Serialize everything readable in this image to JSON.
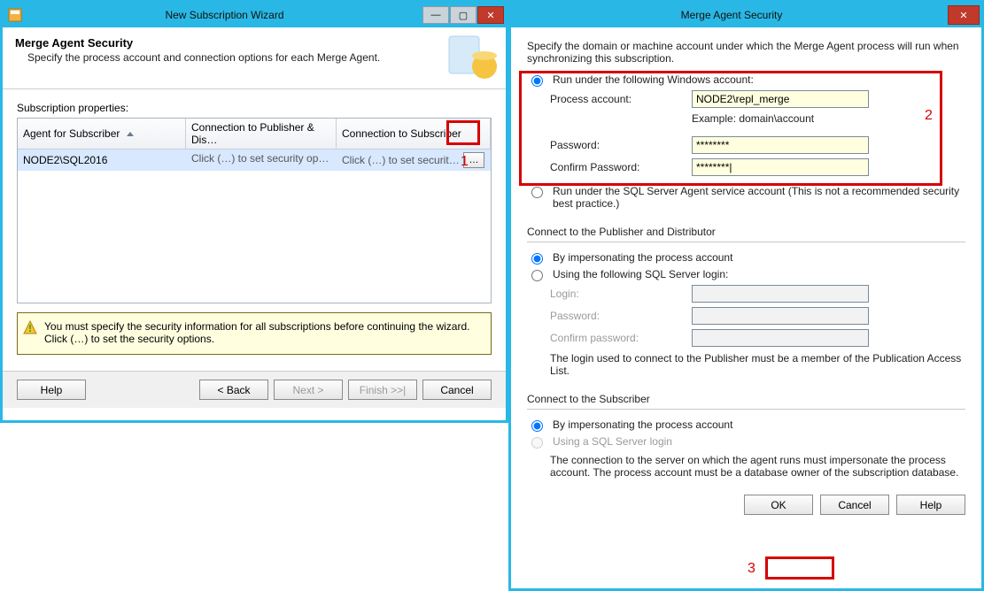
{
  "wizard": {
    "title": "New Subscription Wizard",
    "page_heading": "Merge Agent Security",
    "page_sub": "Specify the process account and connection options for each Merge Agent.",
    "grid_label": "Subscription properties:",
    "columns": {
      "agent": "Agent for Subscriber",
      "conn_pub": "Connection to Publisher & Dis…",
      "conn_sub": "Connection to Subscriber"
    },
    "row": {
      "agent": "NODE2\\SQL2016",
      "conn_pub": "Click (…) to set security opti…",
      "conn_sub": "Click (…) to set security opti…"
    },
    "warning": "You must specify the security information for all subscriptions before continuing the wizard. Click (…) to set the security options.",
    "buttons": {
      "help": "Help",
      "back": "< Back",
      "next": "Next >",
      "finish": "Finish >>|",
      "cancel": "Cancel"
    }
  },
  "dlg": {
    "title": "Merge Agent Security",
    "intro": "Specify the domain or machine account under which the Merge Agent process will run when synchronizing this subscription.",
    "run_win": "Run under the following Windows account:",
    "process_account_lbl": "Process account:",
    "process_account_val": "NODE2\\repl_merge",
    "example": "Example: domain\\account",
    "password_lbl": "Password:",
    "password_val": "********",
    "confirm_lbl": "Confirm Password:",
    "confirm_val": "********|",
    "run_sqlagent": "Run under the SQL Server Agent service account (This is not a recommended security best practice.)",
    "pubdist_label": "Connect to the Publisher and Distributor",
    "impersonate": "By impersonating the process account",
    "sql_login_opt": "Using the following SQL Server login:",
    "login_lbl": "Login:",
    "pd_password_lbl": "Password:",
    "pd_confirm_lbl": "Confirm password:",
    "pd_note": "The login used to connect to the Publisher must be a member of the Publication Access List.",
    "sub_label": "Connect to the Subscriber",
    "sub_impersonate": "By impersonating the process account",
    "sub_sqllogin": "Using a SQL Server login",
    "sub_note": "The connection to the server on which the agent runs must impersonate the process account. The process account must be a database owner of the subscription database.",
    "ok": "OK",
    "cancel": "Cancel",
    "help": "Help"
  },
  "callouts": {
    "n1": "1",
    "n2": "2",
    "n3": "3"
  }
}
